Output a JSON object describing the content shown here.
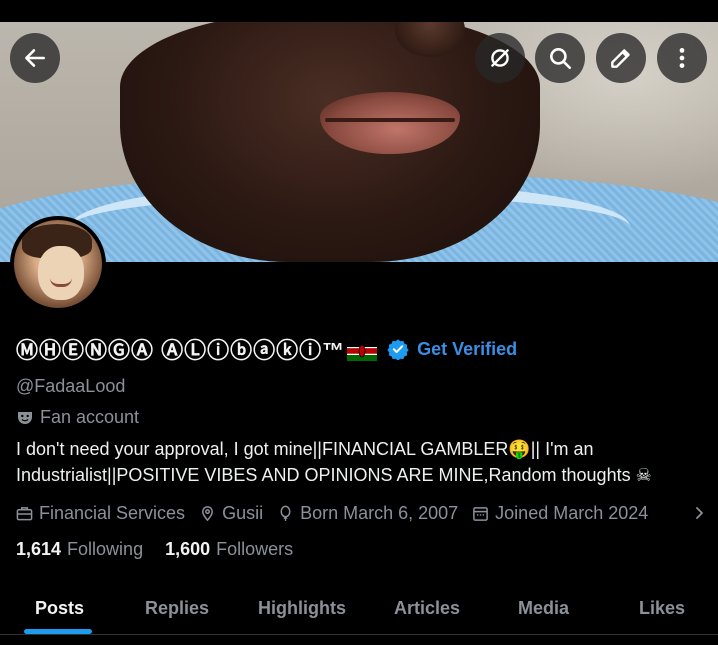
{
  "header": {
    "back_icon": "arrow-left-icon",
    "action_icons": [
      "unfollow-circle-icon",
      "search-icon",
      "edit-icon",
      "more-vertical-icon"
    ]
  },
  "profile": {
    "display_name": "ⓂⒽⒺⓃⒼⒶ ⒶⓁⓘⓑⓐⓚⓘ™",
    "flag": "kenya-flag",
    "verified_icon": "verified-badge-icon",
    "get_verified": "Get Verified",
    "handle": "@FadaaLood",
    "category": "Fan account",
    "bio": "I don't need your approval, I got mine||FINANCIAL GAMBLER🤑|| I'm an Industrialist||POSITIVE VIBES AND OPINIONS ARE MINE,Random thoughts ☠",
    "meta": {
      "profession": "Financial Services",
      "location": "Gusii",
      "born": "Born March 6, 2007",
      "joined": "Joined March 2024"
    },
    "following_count": "1,614",
    "following_label": "Following",
    "followers_count": "1,600",
    "followers_label": "Followers"
  },
  "tabs": [
    "Posts",
    "Replies",
    "Highlights",
    "Articles",
    "Media",
    "Likes"
  ],
  "active_tab": "Posts",
  "colors": {
    "background": "#000000",
    "accent": "#1d9bf0",
    "verified_text": "#3a8ee6",
    "muted": "#8b9198"
  }
}
